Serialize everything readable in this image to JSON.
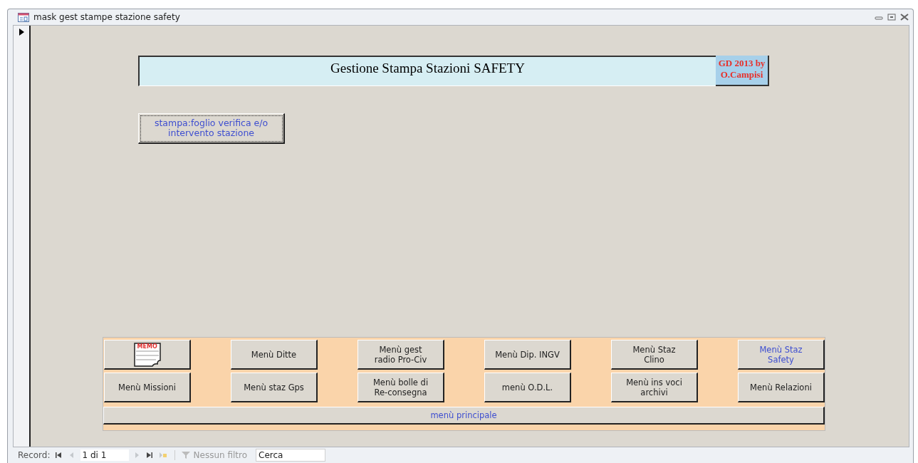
{
  "window": {
    "title": "mask gest stampe stazione safety"
  },
  "header": {
    "title": "Gestione Stampa Stazioni SAFETY",
    "credit": "GD 2013 by O.Campisi"
  },
  "print_button": {
    "label": "stampa:foglio verifica e/o intervento stazione",
    "focused": true
  },
  "menu_buttons": [
    {
      "kind": "icon",
      "label": "MEMO"
    },
    {
      "kind": "text",
      "label": "Menù Ditte",
      "current": false
    },
    {
      "kind": "text",
      "label": "Menù gest radio Pro-Civ",
      "current": false
    },
    {
      "kind": "text",
      "label": "Menù Dip. INGV",
      "current": false
    },
    {
      "kind": "text",
      "label": "Menù Staz Clino",
      "current": false
    },
    {
      "kind": "text",
      "label": "Menù Staz Safety",
      "current": true
    },
    {
      "kind": "text",
      "label": "Menù Missioni",
      "current": false
    },
    {
      "kind": "text",
      "label": "Menù staz Gps",
      "current": false
    },
    {
      "kind": "text",
      "label": "Menù bolle di Re-consegna",
      "current": false
    },
    {
      "kind": "text",
      "label": "menù O.D.L.",
      "current": false
    },
    {
      "kind": "text",
      "label": "Menù ins voci archivi",
      "current": false
    },
    {
      "kind": "text",
      "label": "Menù Relazioni",
      "current": false
    }
  ],
  "main_menu_button": {
    "label": "menù principale"
  },
  "status_bar": {
    "record_label": "Record:",
    "position": "1 di 1",
    "nav_buttons": [
      {
        "kind": "first",
        "disabled": false
      },
      {
        "kind": "prev",
        "disabled": true
      },
      {
        "kind": "next",
        "disabled": true
      },
      {
        "kind": "last",
        "disabled": false
      },
      {
        "kind": "new",
        "disabled": true
      }
    ],
    "filter": {
      "label": "Nessun filtro",
      "disabled": true
    },
    "search": {
      "placeholder": "Cerca"
    }
  }
}
